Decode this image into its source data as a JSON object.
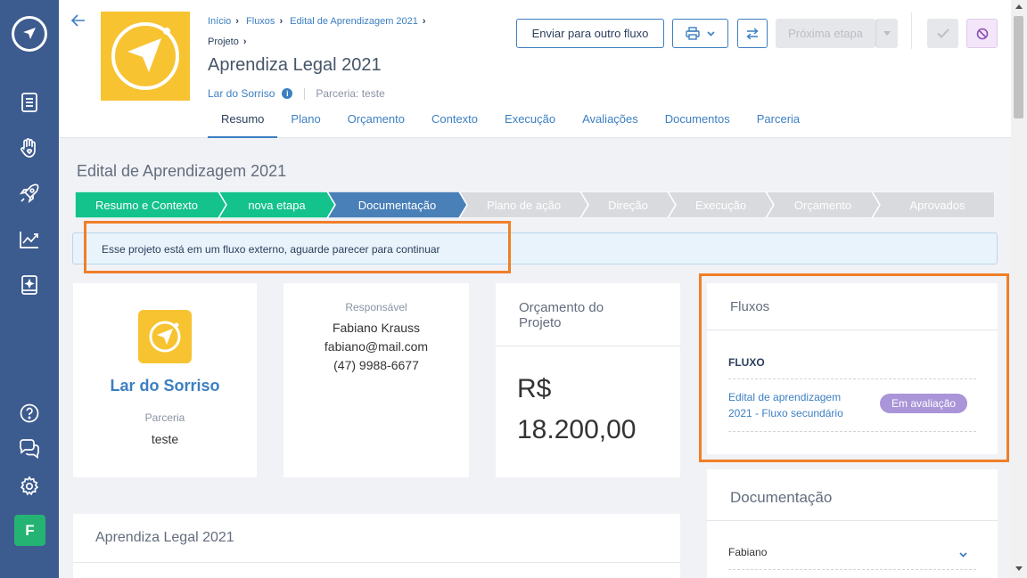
{
  "sidebar": {
    "icons": [
      "logo-icon",
      "document-icon",
      "hand-heart-icon",
      "rocket-icon",
      "chart-icon",
      "notebook-icon",
      "help-icon",
      "chat-icon",
      "settings-icon"
    ],
    "avatar_letter": "F"
  },
  "header": {
    "breadcrumb": [
      "Início",
      "Fluxos",
      "Edital de Aprendizagem 2021"
    ],
    "breadcrumb_last": "Projeto",
    "title": "Aprendiza Legal 2021",
    "org": "Lar do Sorriso",
    "partnership": "Parceria: teste",
    "send_button": "Enviar para outro fluxo",
    "next_button": "Próxima etapa",
    "tabs": [
      "Resumo",
      "Plano",
      "Orçamento",
      "Contexto",
      "Execução",
      "Avaliações",
      "Documentos",
      "Parceria"
    ]
  },
  "main": {
    "section_title": "Edital de Aprendizagem 2021",
    "steps": [
      "Resumo e Contexto",
      "nova etapa",
      "Documentação",
      "Plano de ação",
      "Direção",
      "Execução",
      "Orçamento",
      "Aprovados"
    ],
    "alert": "Esse projeto está em um fluxo externo, aguarde parecer para continuar"
  },
  "org_card": {
    "name": "Lar do Sorriso",
    "label": "Parceria",
    "value": "teste"
  },
  "responsible_card": {
    "label": "Responsável",
    "name": "Fabiano Krauss",
    "email": "fabiano@mail.com",
    "phone": "(47) 9988-6677"
  },
  "budget_card": {
    "title_line1": "Orçamento do",
    "title_line2": "Projeto",
    "currency": "R$",
    "amount": "18.200,00"
  },
  "flows_panel": {
    "title": "Fluxos",
    "column": "FLUXO",
    "link_line1": "Edital de aprendizagem",
    "link_line2": "2021 - Fluxo secundário",
    "status": "Em avaliação"
  },
  "bottom_card": {
    "title": "Aprendiza Legal 2021"
  },
  "docs_panel": {
    "title": "Documentação",
    "item": "Fabiano"
  },
  "colors": {
    "sidebar": "#3c5b8e",
    "accent": "#3c7fc1",
    "step_done": "#14c28b",
    "step_current": "#4a80b8",
    "step_pending": "#d9dadd",
    "highlight": "#f07f28",
    "badge": "#a995d8",
    "brand_yellow": "#f7c331"
  }
}
